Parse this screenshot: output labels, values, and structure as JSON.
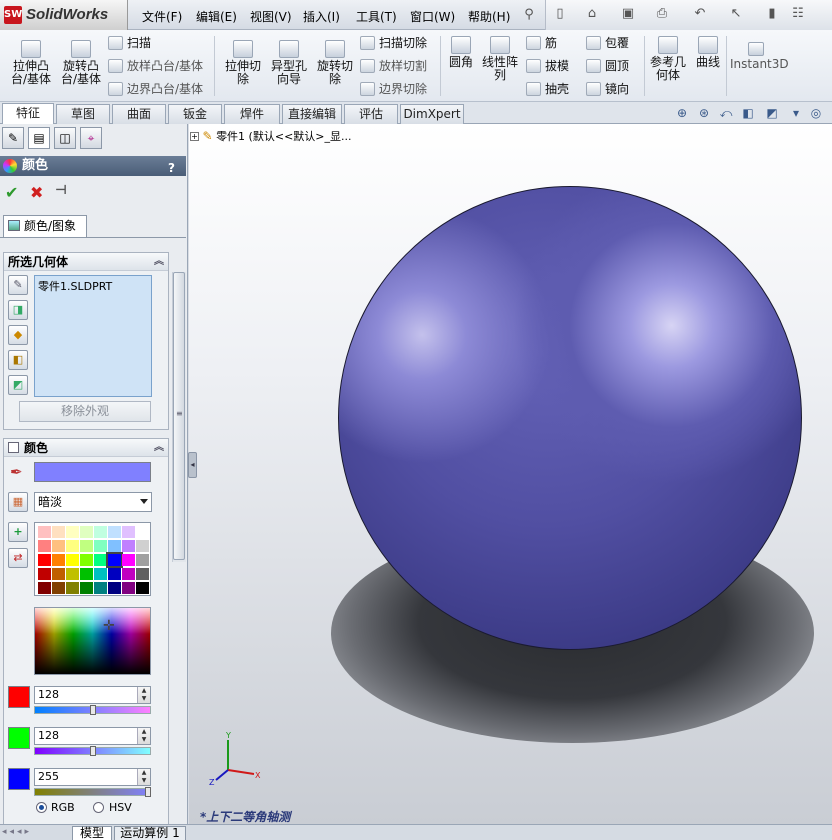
{
  "app": {
    "brand": "SolidWorks",
    "logo_mark": "SW"
  },
  "menubar": {
    "items": [
      "文件(F)",
      "编辑(E)",
      "视图(V)",
      "插入(I)",
      "工具(T)",
      "窗口(W)",
      "帮助(H)"
    ]
  },
  "ribbon": {
    "extrude_boss": "拉伸凸\n台/基体",
    "revolve_boss": "旋转凸\n台/基体",
    "sweep": "扫描",
    "loft": "放样凸台/基体",
    "boundary": "边界凸台/基体",
    "extrude_cut": "拉伸切\n除",
    "hole_wizard": "异型孔\n向导",
    "revolve_cut": "旋转切\n除",
    "swept_cut": "扫描切除",
    "lofted_cut": "放样切割",
    "boundary_cut": "边界切除",
    "fillet": "圆角",
    "linear_pattern": "线性阵\n列",
    "rib": "筋",
    "draft": "拔模",
    "shell": "抽壳",
    "wrap": "包覆",
    "dome": "圆顶",
    "mirror": "镜向",
    "ref_geometry": "参考几\n何体",
    "curves": "曲线",
    "instant3d": "Instant3D"
  },
  "tabs": [
    "特征",
    "草图",
    "曲面",
    "钣金",
    "焊件",
    "直接编辑",
    "评估",
    "DimXpert"
  ],
  "active_tab": "特征",
  "property_manager": {
    "title": "颜色",
    "help": "?",
    "ok_icon": "✔",
    "cancel_icon": "✖",
    "pin_icon": "⊣",
    "subtab": "颜色/图象",
    "selection_group": {
      "header": "所选几何体",
      "items": [
        "零件1.SLDPRT"
      ],
      "remove_button": "移除外观"
    },
    "color_group": {
      "header": "颜色",
      "current_color": "#8080ff",
      "palette_preset": "暗淡",
      "channels": [
        {
          "name": "R",
          "value": "128",
          "swatch": "#ff0000",
          "fraction": 0.502
        },
        {
          "name": "G",
          "value": "128",
          "swatch": "#00ff00",
          "fraction": 0.502
        },
        {
          "name": "B",
          "value": "255",
          "swatch": "#0000ff",
          "fraction": 1.0
        }
      ],
      "mode_rgb": "RGB",
      "mode_hsv": "HSV",
      "selected_mode": "RGB"
    }
  },
  "viewport": {
    "tree_item": "零件1  (默认<<默认>_显...",
    "view_name": "*上下二等角轴测",
    "part_color": "#5553a8"
  },
  "bottom_tabs": [
    "模型",
    "运动算例 1"
  ],
  "palette_colors": [
    [
      "#ffc0c0",
      "#ffe0c0",
      "#ffffc0",
      "#e0ffc0",
      "#c0ffe0",
      "#c0e0ff",
      "#e0c0ff",
      "#ffffff"
    ],
    [
      "#ff8080",
      "#ffc080",
      "#ffff80",
      "#c0ff80",
      "#80ffc0",
      "#80c0ff",
      "#c080ff",
      "#d0d0d0"
    ],
    [
      "#ff0000",
      "#ff8000",
      "#ffff00",
      "#80ff00",
      "#00ff80",
      "#0000ff",
      "#ff00ff",
      "#a0a0a0"
    ],
    [
      "#c00000",
      "#c06000",
      "#c0c000",
      "#00c000",
      "#00c0c0",
      "#0000c0",
      "#c000c0",
      "#606060"
    ],
    [
      "#800000",
      "#804000",
      "#808000",
      "#008000",
      "#008080",
      "#000080",
      "#800080",
      "#000000"
    ]
  ]
}
